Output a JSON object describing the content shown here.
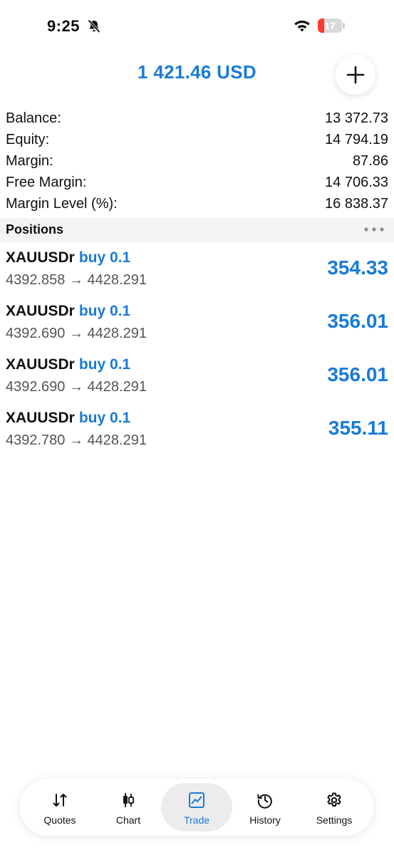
{
  "status_bar": {
    "time": "9:25",
    "battery": "17",
    "battery_level": 0.17
  },
  "header": {
    "title": "1 421.46 USD"
  },
  "account": [
    {
      "label": "Balance:",
      "value": "13 372.73"
    },
    {
      "label": "Equity:",
      "value": "14 794.19"
    },
    {
      "label": "Margin:",
      "value": "87.86"
    },
    {
      "label": "Free Margin:",
      "value": "14 706.33"
    },
    {
      "label": "Margin Level (%):",
      "value": "16 838.37"
    }
  ],
  "positions_section": {
    "title": "Positions"
  },
  "positions": [
    {
      "symbol": "XAUUSDr",
      "side": "buy 0.1",
      "prices": "4392.858 → 4428.291",
      "profit": "354.33"
    },
    {
      "symbol": "XAUUSDr",
      "side": "buy 0.1",
      "prices": "4392.690 → 4428.291",
      "profit": "356.01"
    },
    {
      "symbol": "XAUUSDr",
      "side": "buy 0.1",
      "prices": "4392.690 → 4428.291",
      "profit": "356.01"
    },
    {
      "symbol": "XAUUSDr",
      "side": "buy 0.1",
      "prices": "4392.780 → 4428.291",
      "profit": "355.11"
    }
  ],
  "tabs": [
    {
      "label": "Quotes",
      "icon": "quotes-icon",
      "active": false
    },
    {
      "label": "Chart",
      "icon": "chart-icon",
      "active": false
    },
    {
      "label": "Trade",
      "icon": "trade-icon",
      "active": true
    },
    {
      "label": "History",
      "icon": "history-icon",
      "active": false
    },
    {
      "label": "Settings",
      "icon": "settings-icon",
      "active": false
    }
  ],
  "colors": {
    "accent": "#1a7bd6",
    "battery_low": "#ff3b30",
    "section_bg": "#f3f3f5"
  }
}
